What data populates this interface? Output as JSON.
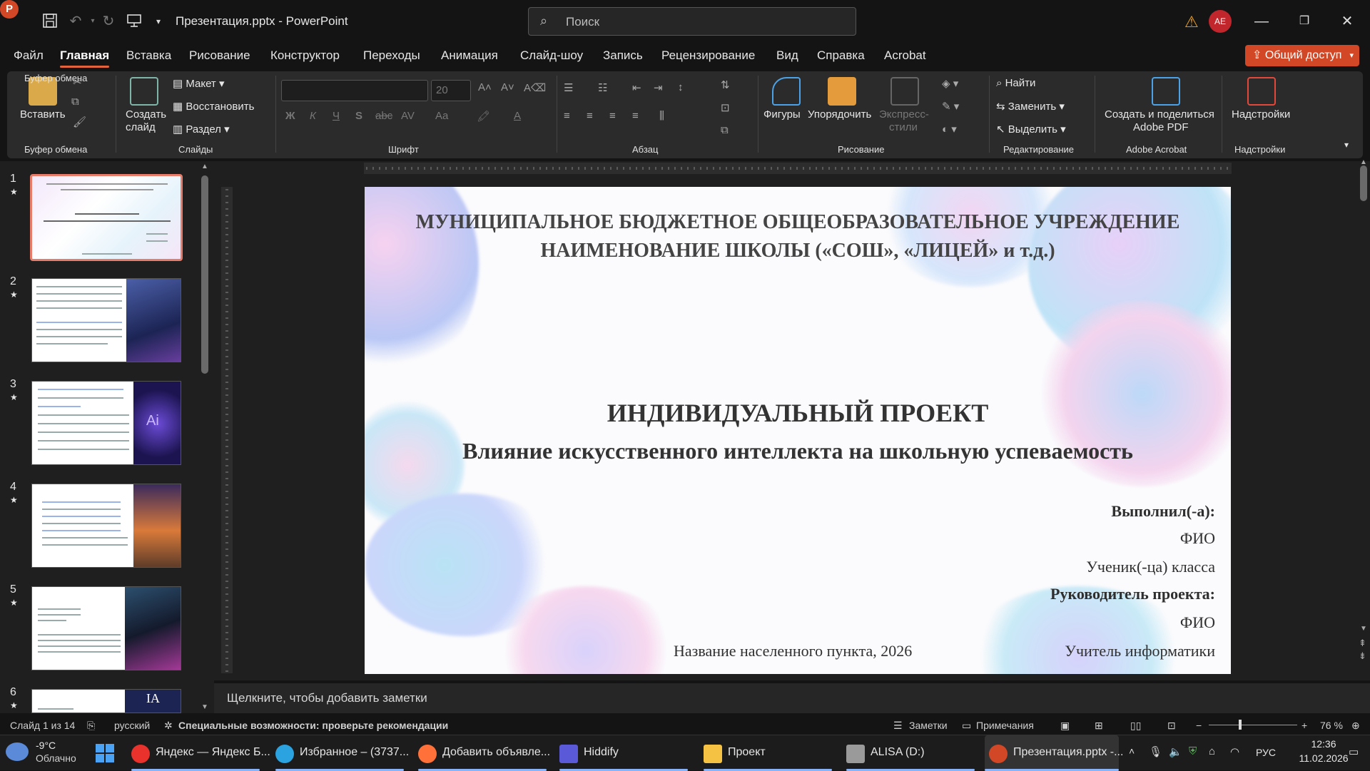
{
  "titlebar": {
    "doc_title": "Презентация.pptx  -  PowerPoint",
    "search_placeholder": "Поиск",
    "avatar_initials": "AE"
  },
  "menu": {
    "tabs": [
      "Файл",
      "Главная",
      "Вставка",
      "Рисование",
      "Конструктор",
      "Переходы",
      "Анимация",
      "Слайд-шоу",
      "Запись",
      "Рецензирование",
      "Вид",
      "Справка",
      "Acrobat"
    ],
    "active_tab": "Главная",
    "share_label": "Общий доступ"
  },
  "ribbon": {
    "clipboard": {
      "paste": "Вставить",
      "group": "Буфер обмена"
    },
    "slides": {
      "new_slide_line1": "Создать",
      "new_slide_line2": "слайд",
      "layout": "Макет",
      "reset": "Восстановить",
      "section": "Раздел",
      "group": "Слайды"
    },
    "font": {
      "font_size": "20",
      "group": "Шрифт",
      "bold": "Ж",
      "italic": "К",
      "underline": "Ч",
      "shadow": "S",
      "strike": "abc",
      "spacing": "AV",
      "case": "Aa"
    },
    "paragraph": {
      "group": "Абзац"
    },
    "drawing": {
      "shapes": "Фигуры",
      "arrange": "Упорядочить",
      "quick_styles_line1": "Экспресс-",
      "quick_styles_line2": "стили",
      "group": "Рисование"
    },
    "editing": {
      "find": "Найти",
      "replace": "Заменить",
      "select": "Выделить",
      "group": "Редактирование"
    },
    "adobe": {
      "create_line1": "Создать и поделиться",
      "create_line2": "Adobe PDF",
      "group": "Adobe Acrobat"
    },
    "addins": {
      "label": "Надстройки",
      "group": "Надстройки"
    }
  },
  "slide_panel": {
    "thumbs": [
      {
        "num": "1"
      },
      {
        "num": "2"
      },
      {
        "num": "3"
      },
      {
        "num": "4"
      },
      {
        "num": "5"
      },
      {
        "num": "6"
      }
    ],
    "thumb3_badge": "Ai",
    "thumb6_badge": "IA"
  },
  "slide": {
    "header_line1": "МУНИЦИПАЛЬНОЕ БЮДЖЕТНОЕ ОБЩЕОБРАЗОВАТЕЛЬНОЕ УЧРЕЖДЕНИЕ",
    "header_line2": "НАИМЕНОВАНИЕ ШКОЛЫ («СОШ», «ЛИЦЕЙ» и т.д.)",
    "title": "ИНДИВИДУАЛЬНЫЙ ПРОЕКТ",
    "subtitle": "Влияние искусственного интеллекта на школьную успеваемость",
    "done_by": "Выполнил(-а):",
    "fio1": "ФИО",
    "student": "Ученик(-ца) класса",
    "supervisor": "Руководитель проекта:",
    "fio2": "ФИО",
    "teacher": "Учитель информатики",
    "city": "Название населенного пункта, 2026"
  },
  "notes_placeholder": "Щелкните, чтобы добавить заметки",
  "status": {
    "slide_of": "Слайд 1 из 14",
    "language": "русский",
    "accessibility": "Специальные возможности: проверьте рекомендации",
    "notes": "Заметки",
    "comments": "Примечания",
    "zoom": "76 %"
  },
  "taskbar": {
    "weather_temp": "-9°C",
    "weather_desc": "Облачно",
    "items": [
      {
        "label": "Яндекс — Яндекс Б..."
      },
      {
        "label": "Избранное – (3737..."
      },
      {
        "label": "Добавить объявле..."
      },
      {
        "label": "Hiddify"
      },
      {
        "label": "Проект"
      },
      {
        "label": "ALISA (D:)"
      },
      {
        "label": "Презентация.pptx -..."
      }
    ],
    "lang": "РУС",
    "time": "12:36",
    "date": "11.02.2026"
  },
  "colors": {
    "accent": "#d24726",
    "tab_underline": "#e3643c",
    "thumb_selected": "#e87c6a"
  }
}
